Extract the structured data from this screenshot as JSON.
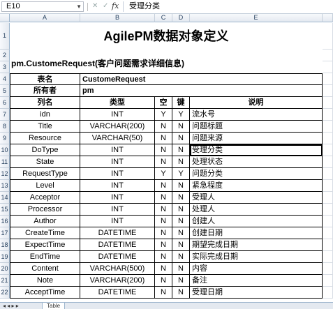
{
  "formula_bar": {
    "name_box": "E10",
    "fx_label": "fx",
    "formula": "受理分类"
  },
  "columns": [
    "A",
    "B",
    "C",
    "D",
    "E"
  ],
  "rows": [
    "1",
    "2",
    "3",
    "4",
    "5",
    "6",
    "7",
    "8",
    "9",
    "10",
    "11",
    "12",
    "13",
    "14",
    "15",
    "16",
    "17",
    "18",
    "19",
    "20",
    "21",
    "22"
  ],
  "sheet": {
    "title": "AgilePM数据对象定义",
    "subtitle": "pm.CustomeRequest(客户问题需求详细信息)",
    "meta": {
      "table_name_label": "表名",
      "table_name_value": "CustomeRequest",
      "owner_label": "所有者",
      "owner_value": "pm"
    },
    "headers": {
      "col_name": "列名",
      "type": "类型",
      "nullable": "空",
      "key": "键",
      "desc": "说明"
    },
    "fields": [
      {
        "name": "idn",
        "type": "INT",
        "nullable": "Y",
        "key": "Y",
        "desc": "流水号"
      },
      {
        "name": "Title",
        "type": "VARCHAR(200)",
        "nullable": "N",
        "key": "N",
        "desc": "问题标题"
      },
      {
        "name": "Resource",
        "type": "VARCHAR(50)",
        "nullable": "N",
        "key": "N",
        "desc": "问题来源"
      },
      {
        "name": "DoType",
        "type": "INT",
        "nullable": "N",
        "key": "N",
        "desc": "受理分类"
      },
      {
        "name": "State",
        "type": "INT",
        "nullable": "N",
        "key": "N",
        "desc": "处理状态"
      },
      {
        "name": "RequestType",
        "type": "INT",
        "nullable": "Y",
        "key": "Y",
        "desc": "问题分类"
      },
      {
        "name": "Level",
        "type": "INT",
        "nullable": "N",
        "key": "N",
        "desc": "紧急程度"
      },
      {
        "name": "Acceptor",
        "type": "INT",
        "nullable": "N",
        "key": "N",
        "desc": "受理人"
      },
      {
        "name": "Processor",
        "type": "INT",
        "nullable": "N",
        "key": "N",
        "desc": "处理人"
      },
      {
        "name": "Author",
        "type": "INT",
        "nullable": "N",
        "key": "N",
        "desc": "创建人"
      },
      {
        "name": "CreateTime",
        "type": "DATETIME",
        "nullable": "N",
        "key": "N",
        "desc": "创建日期"
      },
      {
        "name": "ExpectTime",
        "type": "DATETIME",
        "nullable": "N",
        "key": "N",
        "desc": "期望完成日期"
      },
      {
        "name": "EndTime",
        "type": "DATETIME",
        "nullable": "N",
        "key": "N",
        "desc": "实际完成日期"
      },
      {
        "name": "Content",
        "type": "VARCHAR(500)",
        "nullable": "N",
        "key": "N",
        "desc": "内容"
      },
      {
        "name": "Note",
        "type": "VARCHAR(200)",
        "nullable": "N",
        "key": "N",
        "desc": "备注"
      },
      {
        "name": "AcceptTime",
        "type": "DATETIME",
        "nullable": "N",
        "key": "N",
        "desc": "受理日期"
      }
    ]
  },
  "tabbar": {
    "nav": "◂ ◂ ▸ ▸",
    "sheet_tab": "Table"
  }
}
